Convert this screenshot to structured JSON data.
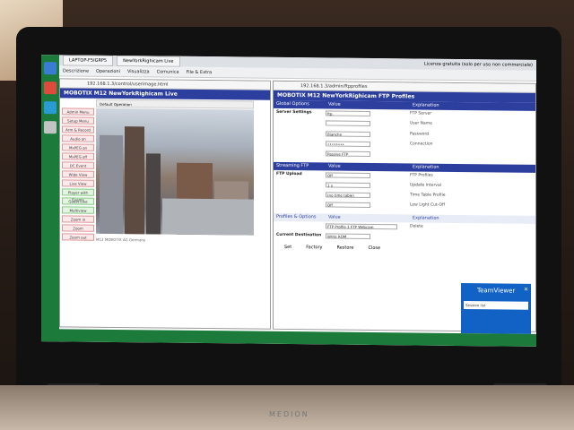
{
  "browser": {
    "tab_title": "LAPTOP-F5IGRP5",
    "tab2": "NewYorkRighicam Live",
    "menu": [
      "Descrizione",
      "Operazioni",
      "Visualizza",
      "Comunica",
      "File & Extra"
    ],
    "right_note": "Licenza gratuita (solo per uso non commerciale)"
  },
  "left_window": {
    "url": "192.168.1.3/control/userimage.html",
    "title": "MOBOTIX M12   NewYorkRighicam Live",
    "toolbar": "Default Operation",
    "side_buttons": [
      {
        "label": "Admin Menu",
        "g": false
      },
      {
        "label": "Setup Menu",
        "g": false
      },
      {
        "label": "Arm & Record",
        "g": false
      },
      {
        "label": "Audio on",
        "g": false
      },
      {
        "label": "MxPEG on",
        "g": false
      },
      {
        "label": "MxPEG off",
        "g": false
      },
      {
        "label": "DC Event",
        "g": false
      },
      {
        "label": "Wide View",
        "g": false
      },
      {
        "label": "Live View",
        "g": false
      },
      {
        "label": "Player with Events",
        "g": true
      },
      {
        "label": "Guest Live",
        "g": true
      },
      {
        "label": "Multiview",
        "g": true
      },
      {
        "label": "Zoom in",
        "g": false
      },
      {
        "label": "Zoom",
        "g": false
      },
      {
        "label": "Zoom out",
        "g": false
      }
    ],
    "footer": "M12 MOBOTIX AG   Germany"
  },
  "right_window": {
    "url": "192.168.1.3/admin/ftpprofiles",
    "title": "MOBOTIX M12   NewYorkRighicam FTP Profiles",
    "headers": [
      "Global Options",
      "Value",
      "Explanation"
    ],
    "rows": [
      {
        "label": "Server Settings",
        "value": "ftp.",
        "expl": "FTP Server"
      },
      {
        "label": "",
        "value": "",
        "expl": "User Name"
      },
      {
        "label": "",
        "value": "Bianche",
        "expl": "Password"
      },
      {
        "label": "",
        "value": "••••••••",
        "expl": "Connection"
      },
      {
        "label": "",
        "value": "Passive FTP",
        "expl": ""
      }
    ],
    "streaming": [
      "Streaming FTP",
      "Value",
      "Explanation"
    ],
    "stream_rows": [
      {
        "label": "FTP Upload",
        "value": "Off",
        "expl": "FTP Profiles"
      },
      {
        "label": "",
        "value": "1 s",
        "expl": "Update Interval"
      },
      {
        "label": "",
        "value": "(no time table)",
        "expl": "Time Table Profile"
      },
      {
        "label": "",
        "value": "Off",
        "expl": "Low Light Cut-Off"
      }
    ],
    "profiles": [
      "Profiles & Options",
      "Value",
      "Explanation"
    ],
    "profile_name": "FTP Profile 1  FTP Webcam",
    "current_dest": "Current Destination",
    "dest_value": "Write ROM",
    "delete": "Delete",
    "buttons": [
      "Set",
      "Factory",
      "Restore",
      "Close"
    ]
  },
  "teamviewer": {
    "title": "TeamViewer",
    "session": "Session list"
  },
  "laptop_brand": "MEDION"
}
